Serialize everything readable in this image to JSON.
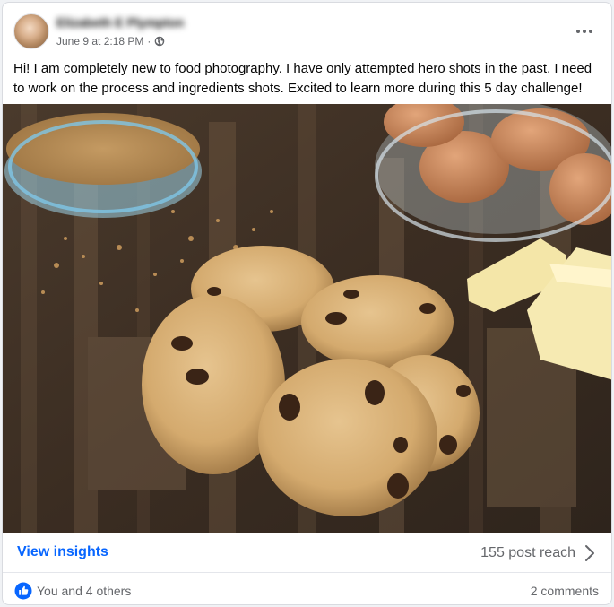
{
  "post": {
    "author": "Elizabeth E Plympton",
    "timestamp": "June 9 at 2:18 PM",
    "separator": "·",
    "privacy_icon": "globe-icon",
    "more_icon": "more-horizontal-icon",
    "text": "Hi! I am completely new to food photography. I have only attempted hero shots in the past.  I need to work on the process and ingredients shots. Excited to learn more during this 5 day challenge!"
  },
  "footer": {
    "insights_label": "View insights",
    "reach_label": "155 post reach",
    "reach_icon": "chevron-right-icon",
    "reaction_icon": "like-icon",
    "reactors_label": "You and 4 others",
    "comments_label": "2 comments"
  },
  "colors": {
    "link": "#0866ff",
    "secondary_text": "#65676b",
    "like_blue": "#0866ff"
  }
}
